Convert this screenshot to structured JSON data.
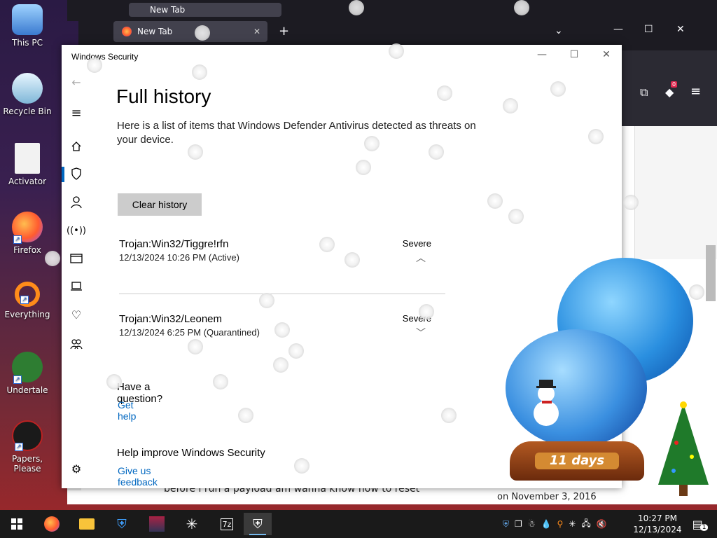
{
  "desktop": {
    "icons": [
      {
        "label": "This PC"
      },
      {
        "label": "Recycle Bin"
      },
      {
        "label": "Activator"
      },
      {
        "label": "Firefox"
      },
      {
        "label": "Everything"
      },
      {
        "label": "Undertale"
      },
      {
        "label": "Papers, Please"
      }
    ]
  },
  "firefox_back": {
    "tab_label": "New Tab"
  },
  "firefox_front": {
    "tab_label": "New Tab",
    "notification_badge": "0",
    "content_text": "before i run a payload am wanna know how to reset",
    "content_date": "on November 3, 2016"
  },
  "window": {
    "title": "Windows Security",
    "heading": "Full history",
    "description": "Here is a list of items that Windows Defender Antivirus detected as threats on your device.",
    "clear_button": "Clear history",
    "threats": [
      {
        "name": "Trojan:Win32/Tiggre!rfn",
        "meta": "12/13/2024 10:26 PM (Active)",
        "severity": "Severe",
        "expanded": true
      },
      {
        "name": "Trojan:Win32/Leonem",
        "meta": "12/13/2024 6:25 PM (Quarantined)",
        "severity": "Severe",
        "expanded": false
      }
    ],
    "question_heading": "Have a question?",
    "help_link": "Get help",
    "improve_heading": "Help improve Windows Security",
    "feedback_link": "Give us feedback"
  },
  "globe": {
    "days_label": "11 days"
  },
  "taskbar": {
    "time": "10:27 PM",
    "date": "12/13/2024",
    "notification_count": "1"
  },
  "colors": {
    "accent": "#0067c0",
    "taskbar": "#1a1a1a",
    "firefox_dark": "#1c1b22"
  }
}
